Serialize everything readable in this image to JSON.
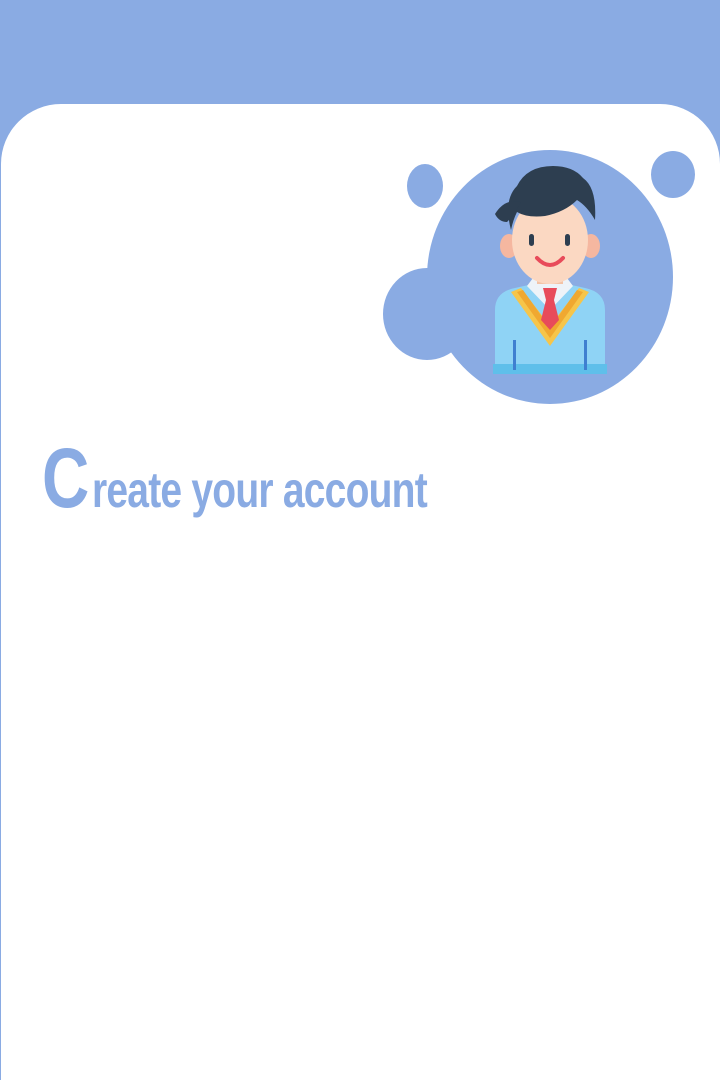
{
  "title": {
    "first_letter": "C",
    "rest": "reate your account"
  },
  "colors": {
    "accent": "#8aabe3",
    "background": "#ffffff"
  },
  "avatar": {
    "icon": "student-avatar-icon"
  }
}
